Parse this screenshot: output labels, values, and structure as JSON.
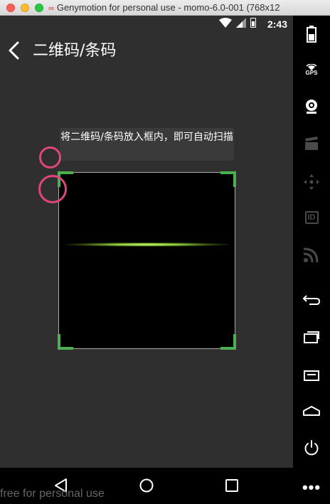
{
  "window": {
    "title": "Genymotion for personal use - momo-6.0-001 (768x12"
  },
  "statusbar": {
    "time": "2:43"
  },
  "appbar": {
    "title": "二维码/条码"
  },
  "scanner": {
    "hint": "将二维码/条码放入框内，即可自动扫描",
    "accent_color": "#4caf50",
    "scan_line_color": "#c6f25a"
  },
  "touch_indicator_color": "#e0457b",
  "watermark": "free for personal use",
  "sidebar": {
    "gps_label": "GPS",
    "id_label": "ID",
    "items": [
      "battery-icon",
      "gps-icon",
      "webcam-icon",
      "clapperboard-icon",
      "dpad-icon",
      "id-icon",
      "rss-icon",
      "back-icon",
      "recents-icon",
      "menu-icon",
      "home-icon",
      "power-icon",
      "more-icon"
    ]
  }
}
